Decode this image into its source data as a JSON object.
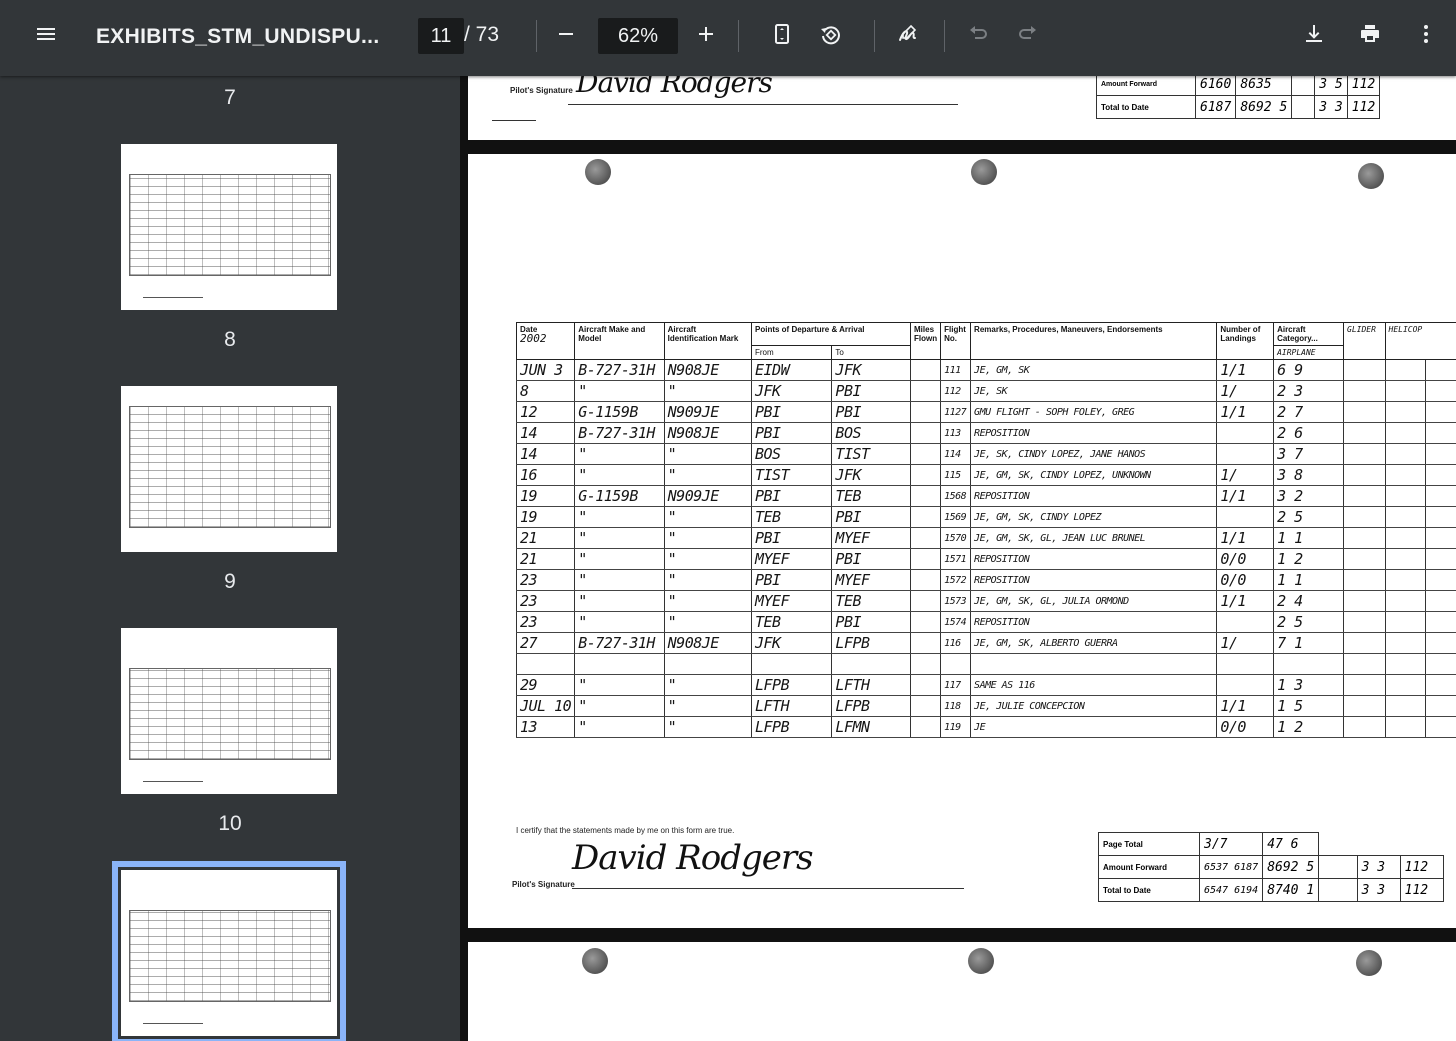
{
  "toolbar": {
    "menu_icon": "hamburger-menu-icon",
    "title": "EXHIBITS_STM_UNDISPU...",
    "current_page": "11",
    "page_total": "/ 73",
    "zoom": "62%",
    "icons": [
      "minus-icon",
      "plus-icon",
      "fit-page-icon",
      "rotate-icon",
      "annotate-pen-icon",
      "undo-icon",
      "redo-icon",
      "download-icon",
      "print-icon",
      "more-vert-icon"
    ]
  },
  "sidebar": {
    "thumbnails": [
      {
        "label": "7"
      },
      {
        "label": "8"
      },
      {
        "label": "9"
      },
      {
        "label": "10"
      }
    ]
  },
  "prev_page": {
    "signature_label": "Pilot's Signature",
    "signature": "David Rodgers",
    "total_to_date_label": "Total to Date",
    "amount_forward_label": "Amount Forward",
    "values": [
      "6160",
      "8635",
      "3 5",
      "112",
      "6187",
      "8692 5",
      "3 3",
      "112"
    ]
  },
  "logbook": {
    "year": "2002",
    "headers": {
      "date": "Date",
      "aircraft_make": "Aircraft Make and Model",
      "aircraft_id": "Aircraft Identification Mark",
      "points": "Points of Departure & Arrival",
      "from": "From",
      "to": "To",
      "miles": "Miles Flown",
      "flight": "Flight No.",
      "remarks": "Remarks, Procedures, Maneuvers, Endorsements",
      "landings": "Number of Landings",
      "category": "Aircraft Category...",
      "airplane": "AIRPLANE",
      "glider": "GLIDER",
      "helicopter": "HELICOP"
    },
    "rows": [
      {
        "date": "JUN 3",
        "make": "B-727-31H",
        "id": "N908JE",
        "from": "EIDW",
        "to": "JFK",
        "flight": "111",
        "remarks": "JE, GM, SK",
        "land": "1/1",
        "hours": "6 9"
      },
      {
        "date": "8",
        "make": "\"",
        "id": "\"",
        "from": "JFK",
        "to": "PBI",
        "flight": "112",
        "remarks": "JE, SK",
        "land": "1/",
        "hours": "2 3"
      },
      {
        "date": "12",
        "make": "G-1159B",
        "id": "N909JE",
        "from": "PBI",
        "to": "PBI",
        "flight": "1127",
        "remarks": "GMU FLIGHT - SOPH FOLEY, GREG",
        "land": "1/1",
        "hours": "2 7"
      },
      {
        "date": "14",
        "make": "B-727-31H",
        "id": "N908JE",
        "from": "PBI",
        "to": "BOS",
        "flight": "113",
        "remarks": "REPOSITION",
        "land": "",
        "hours": "2 6"
      },
      {
        "date": "14",
        "make": "\"",
        "id": "\"",
        "from": "BOS",
        "to": "TIST",
        "flight": "114",
        "remarks": "JE, SK, CINDY LOPEZ, JANE HANOS",
        "land": "",
        "hours": "3 7"
      },
      {
        "date": "16",
        "make": "\"",
        "id": "\"",
        "from": "TIST",
        "to": "JFK",
        "flight": "115",
        "remarks": "JE, GM, SK, CINDY LOPEZ, UNKNOWN",
        "land": "1/",
        "hours": "3 8"
      },
      {
        "date": "19",
        "make": "G-1159B",
        "id": "N909JE",
        "from": "PBI",
        "to": "TEB",
        "flight": "1568",
        "remarks": "REPOSITION",
        "land": "1/1",
        "hours": "3 2"
      },
      {
        "date": "19",
        "make": "\"",
        "id": "\"",
        "from": "TEB",
        "to": "PBI",
        "flight": "1569",
        "remarks": "JE, GM, SK, CINDY LOPEZ",
        "land": "",
        "hours": "2 5"
      },
      {
        "date": "21",
        "make": "\"",
        "id": "\"",
        "from": "PBI",
        "to": "MYEF",
        "flight": "1570",
        "remarks": "JE, GM, SK, GL, JEAN LUC BRUNEL",
        "land": "1/1",
        "hours": "1 1"
      },
      {
        "date": "21",
        "make": "\"",
        "id": "\"",
        "from": "MYEF",
        "to": "PBI",
        "flight": "1571",
        "remarks": "REPOSITION",
        "land": "0/0",
        "hours": "1 2"
      },
      {
        "date": "23",
        "make": "\"",
        "id": "\"",
        "from": "PBI",
        "to": "MYEF",
        "flight": "1572",
        "remarks": "REPOSITION",
        "land": "0/0",
        "hours": "1 1"
      },
      {
        "date": "23",
        "make": "\"",
        "id": "\"",
        "from": "MYEF",
        "to": "TEB",
        "flight": "1573",
        "remarks": "JE, GM, SK, GL, JULIA ORMOND",
        "land": "1/1",
        "hours": "2 4"
      },
      {
        "date": "23",
        "make": "\"",
        "id": "\"",
        "from": "TEB",
        "to": "PBI",
        "flight": "1574",
        "remarks": "REPOSITION",
        "land": "",
        "hours": "2 5"
      },
      {
        "date": "27",
        "make": "B-727-31H",
        "id": "N908JE",
        "from": "JFK",
        "to": "LFPB",
        "flight": "116",
        "remarks": "JE, GM, SK, ALBERTO GUERRA",
        "land": "1/",
        "hours": "7 1"
      },
      {
        "date": "",
        "make": "",
        "id": "",
        "from": "",
        "to": "",
        "flight": "",
        "remarks": "",
        "land": "",
        "hours": ""
      },
      {
        "date": "29",
        "make": "\"",
        "id": "\"",
        "from": "LFPB",
        "to": "LFTH",
        "flight": "117",
        "remarks": "SAME AS 116",
        "land": "",
        "hours": "1 3"
      },
      {
        "date": "JUL 10",
        "make": "\"",
        "id": "\"",
        "from": "LFTH",
        "to": "LFPB",
        "flight": "118",
        "remarks": "JE, JULIE CONCEPCION",
        "land": "1/1",
        "hours": "1 5"
      },
      {
        "date": "13",
        "make": "\"",
        "id": "\"",
        "from": "LFPB",
        "to": "LFMN",
        "flight": "119",
        "remarks": "JE",
        "land": "0/0",
        "hours": "1 2"
      }
    ],
    "certify_text": "I certify that the statements made by me on this form are true.",
    "signature_label": "Pilot's Signature",
    "signature": "David Rodgers",
    "totals": {
      "page_total_label": "Page Total",
      "amount_forward_label": "Amount Forward",
      "total_to_date_label": "Total to Date",
      "page_total": [
        "3/7",
        "47 6"
      ],
      "amount_forward": [
        "6537 6187",
        "8692 5",
        "3 3",
        "112"
      ],
      "total_to_date": [
        "6547 6194",
        "8740 1",
        "3 3",
        "112"
      ]
    }
  }
}
